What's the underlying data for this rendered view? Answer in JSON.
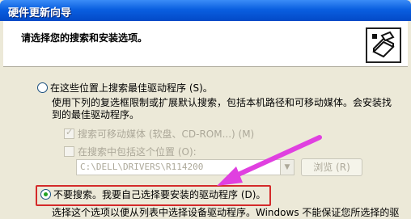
{
  "window": {
    "title": "硬件更新向导"
  },
  "header": {
    "heading": "请选择您的搜索和安装选项。"
  },
  "option_search": {
    "label": "在这些位置上搜索最佳驱动程序 (S)。",
    "description": "使用下列的复选框限制或扩展默认搜索，包括本机路径和可移动媒体。会安装找到的最佳驱动程序。"
  },
  "checkbox_removable": {
    "label": "搜索可移动媒体 (软盘、CD-ROM...) (M)",
    "checked": true,
    "enabled": false
  },
  "checkbox_location": {
    "label": "在搜索中包括这个位置 (O):",
    "checked": false,
    "enabled": false
  },
  "path_combo": {
    "value": "C:\\DELL\\DRIVERS\\R114200"
  },
  "browse_button": {
    "label": "浏览 (R)"
  },
  "option_dont_search": {
    "label": "不要搜索。我要自己选择要安装的驱动程序 (D)。",
    "description": "选择这个选项以便从列表中选择设备驱动程序。Windows 不能保证您所选择的驱"
  },
  "colors": {
    "title_bar": "#0a5fe0",
    "highlight_box": "#d42a2a",
    "arrow": "#e040e0"
  }
}
